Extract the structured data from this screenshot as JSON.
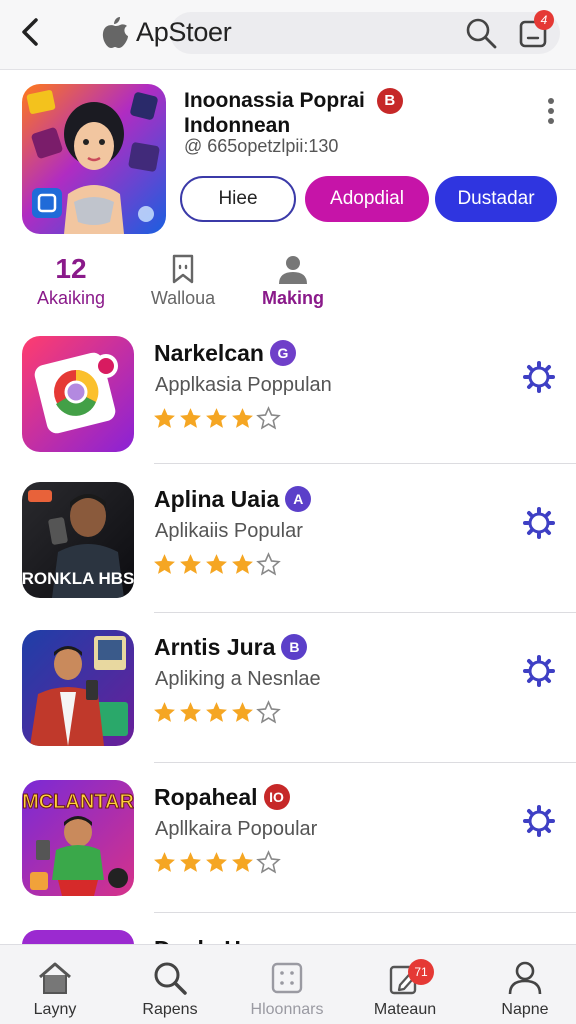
{
  "header": {
    "title": "ApStoer",
    "notification_count": "4"
  },
  "featured": {
    "title_line1": "Inoonassia Poprai",
    "title_line2": "Indonnean",
    "title_badge": "B",
    "subtitle": "@ 665opetzlpii:130",
    "buttons": [
      "Hiee",
      "Adopdial",
      "Dustadar"
    ]
  },
  "stats": [
    {
      "value": "12",
      "label": "Akaiking",
      "icon": null
    },
    {
      "value": null,
      "label": "Walloua",
      "icon": "bookmark-icon"
    },
    {
      "value": null,
      "label": "Making",
      "icon": "person-icon"
    }
  ],
  "apps": [
    {
      "name": "Narkelcan",
      "badge": "G",
      "badge_color": "#6f3fc9",
      "subtitle": "Applkasia Poppulan",
      "rating": 4
    },
    {
      "name": "Aplina Uaia",
      "badge": "A",
      "badge_color": "#5b3fc9",
      "subtitle": "Aplikaiis Popular",
      "rating": 4
    },
    {
      "name": "Arntis Jura",
      "badge": "B",
      "badge_color": "#5b3fc9",
      "subtitle": "Apliking a Nesnlae",
      "rating": 4
    },
    {
      "name": "Ropaheal",
      "badge": "IO",
      "badge_color": "#c62828",
      "subtitle": "Apllkaira Popoular",
      "rating": 4
    }
  ],
  "app_art_text": {
    "app2": "RONKLA HBS",
    "app4": "MCLANTAR"
  },
  "partial_row": {
    "name": "DuahaHans"
  },
  "bottom_nav": [
    {
      "label": "Layny",
      "icon": "home-icon"
    },
    {
      "label": "Rapens",
      "icon": "search-icon"
    },
    {
      "label": "Hloonnars",
      "icon": "grid-icon"
    },
    {
      "label": "Mateaun",
      "icon": "edit-icon",
      "badge": "71"
    },
    {
      "label": "Napne",
      "icon": "person-icon"
    }
  ],
  "colors": {
    "accent_purple": "#8a1a8a",
    "star": "#f5a623",
    "gear": "#3e3fc4"
  }
}
